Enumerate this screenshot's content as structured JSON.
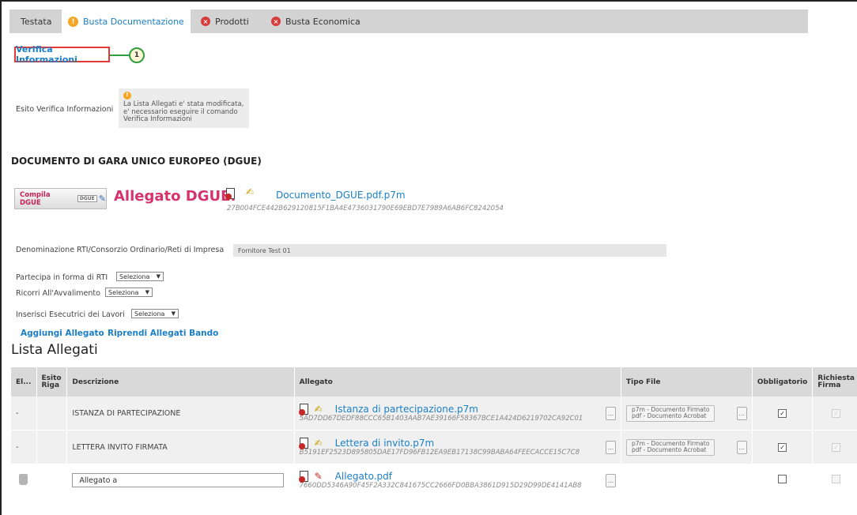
{
  "tabs": [
    {
      "label": "Testata",
      "icon": "",
      "state": "normal"
    },
    {
      "label": "Busta Documentazione",
      "icon": "warning-icon",
      "state": "active"
    },
    {
      "label": "Prodotti",
      "icon": "error-icon",
      "state": "normal"
    },
    {
      "label": "Busta Economica",
      "icon": "error-icon",
      "state": "normal"
    }
  ],
  "verifica": {
    "label": "Verifica Informazioni",
    "callout_number": "1"
  },
  "esito": {
    "label": "Esito Verifica Informazioni",
    "message_line1": "La Lista Allegati e' stata modificata,",
    "message_line2": "e' necessario eseguire il comando",
    "message_line3": "Verifica Informazioni"
  },
  "dgue": {
    "section_title": "DOCUMENTO DI GARA UNICO EUROPEO (DGUE)",
    "compila_label": "Compila DGUE",
    "compila_badge": "DGUE",
    "allegato_label": "Allegato DGUE:",
    "file_name": "Documento_DGUE.pdf.p7m",
    "file_hash": "27B004FCE442B629120815F1BA4E4736031790E69EBD7E7989A6AB6FC8242054"
  },
  "form": {
    "denominazione_label": "Denominazione RTI/Consorzio Ordinario/Reti di Impresa",
    "denominazione_value": "Fornitore Test 01",
    "rti_label": "Partecipa in forma di RTI",
    "avvalimento_label": "Ricorri All'Avvalimento",
    "esecutrici_label": "Inserisci Esecutrici dei Lavori",
    "select_value": "Seleziona"
  },
  "actions": {
    "aggiungi": "Aggiungi Allegato",
    "riprendi": "Riprendi Allegati Bando"
  },
  "lista": {
    "title": "Lista Allegati",
    "headers": {
      "el": "El...",
      "esito_line1": "Esito",
      "esito_line2": "Riga",
      "descrizione": "Descrizione",
      "allegato": "Allegato",
      "tipo": "Tipo File",
      "obbligatorio": "Obbligatorio",
      "firma_line1": "Richiesta",
      "firma_line2": "Firma"
    },
    "rows": [
      {
        "el": "-",
        "descrizione": "ISTANZA DI PARTECIPAZIONE",
        "file": "Istanza di partecipazione.p7m",
        "hash": "5AD7DD67DEDF88CCC65B1403AAB7AE39166F58367BCE1A424D6219702CA92C01",
        "tipo1": "p7m - Documento Firmato",
        "tipo2": "pdf - Documento Acrobat",
        "obbligatorio": true,
        "firma": true
      },
      {
        "el": "-",
        "descrizione": "LETTERA INVITO FIRMATA",
        "file": "Lettera di invito.p7m",
        "hash": "B5191EF2523D895805DAE17FD96FB12EA9EB17138C99BABA64FEECACCE15C7C8",
        "tipo1": "p7m - Documento Firmato",
        "tipo2": "pdf - Documento Acrobat",
        "obbligatorio": true,
        "firma": true
      },
      {
        "el": "",
        "descrizione": "Allegato a",
        "file": "Allegato.pdf",
        "hash": "7660DD5346A90F45F2A332C841675CC2666FD0BBA3861D915D29D99DE4141AB8",
        "tipo1": "",
        "tipo2": "",
        "obbligatorio": false,
        "firma": false
      }
    ],
    "dots_label": "..."
  }
}
